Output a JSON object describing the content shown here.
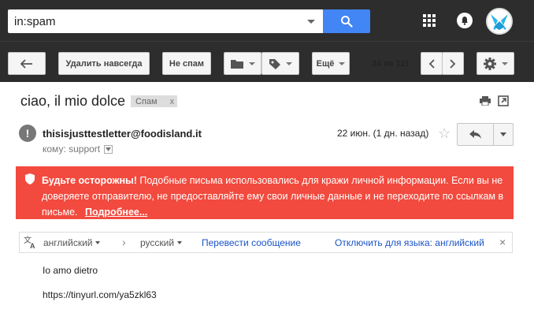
{
  "search": {
    "query": "in:spam"
  },
  "toolbar": {
    "delete_forever_label": "Удалить навсегда",
    "not_spam_label": "Не спам",
    "more_label": "Ещё",
    "page_count": "34 из 111"
  },
  "message": {
    "subject": "ciao, il mio dolce",
    "label": "Спам",
    "label_close": "x",
    "sender": "thisisjusttestletter@foodisland.it",
    "to_line": "кому: support",
    "date": "22 июн. (1 дн. назад)",
    "star": "☆"
  },
  "warning": {
    "title": "Будьте осторожны!",
    "text": "Подобные письма использовались для кражи личной информации. Если вы не доверяете отправителю, не предоставляйте ему свои личные данные и не переходите по ссылкам в письме.",
    "link": "Подробнее..."
  },
  "translate": {
    "from_lang": "английский",
    "arrow": "›",
    "to_lang": "русский",
    "translate_link": "Перевести сообщение",
    "disable_link": "Отключить для языка: английский",
    "close": "×"
  },
  "body": {
    "line1": "Io amo dietro",
    "line2": "https://tinyurl.com/ya5zkl63"
  },
  "colors": {
    "topbar": "#2d2d2d",
    "search_button": "#4285f4",
    "warning_bg": "#f24a3e",
    "link": "#1a53c8"
  }
}
